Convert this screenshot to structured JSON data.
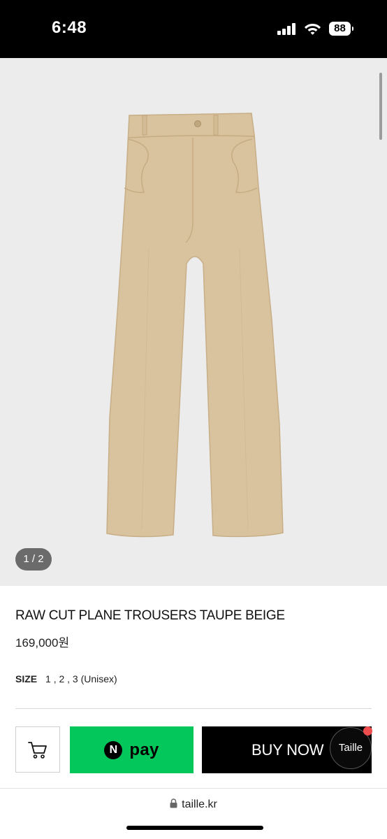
{
  "status_bar": {
    "time": "6:48",
    "battery": "88"
  },
  "gallery": {
    "page_indicator": "1 / 2"
  },
  "product": {
    "title": "RAW CUT PLANE TROUSERS TAUPE BEIGE",
    "price": "169,000원",
    "size_label": "SIZE",
    "size_values": "1 , 2 , 3 (Unisex)"
  },
  "actions": {
    "npay_logo": "N",
    "npay_label": "pay",
    "buy_label": "BUY NOW",
    "chat_label": "Taille"
  },
  "browser": {
    "url": "taille.kr"
  },
  "colors": {
    "npay_green": "#03c75a",
    "buy_background": "#000000",
    "notification_dot": "#f04e4e",
    "trousers_beige": "#d9c39f"
  },
  "icons": {
    "signal": "signal-icon",
    "wifi": "wifi-icon",
    "cart": "cart-icon",
    "lock": "lock-icon"
  }
}
